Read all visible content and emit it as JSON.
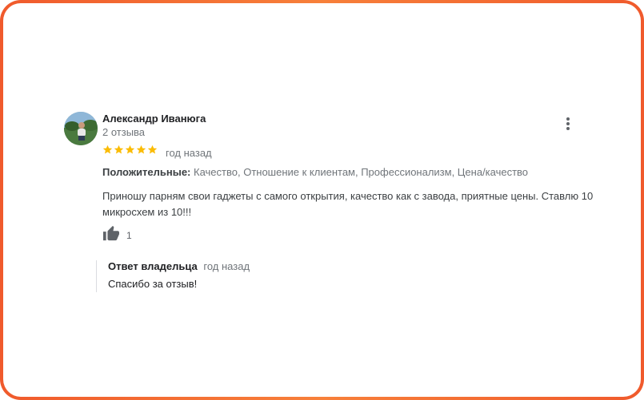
{
  "review": {
    "author": "Александр Иванюга",
    "reviews_count": "2 отзыва",
    "rating": 5,
    "time": "год назад",
    "positive_label": "Положительные:",
    "positive_values": "Качество, Отношение к клиентам, Профессионализм, Цена/качество",
    "text": "Приношу парням свои гаджеты с самого открытия, качество как с завода, приятные цены. Ставлю 10 микросхем из 10!!!",
    "likes": "1",
    "icons": {
      "menu": "more-vert-icon",
      "like": "thumb-up-icon",
      "star": "star-icon"
    }
  },
  "owner_reply": {
    "label": "Ответ владельца",
    "time": "год назад",
    "text": "Спасибо за отзыв!"
  },
  "colors": {
    "frame_border": "#f05a2c",
    "star": "#fbbc04",
    "secondary_text": "#70757a"
  }
}
